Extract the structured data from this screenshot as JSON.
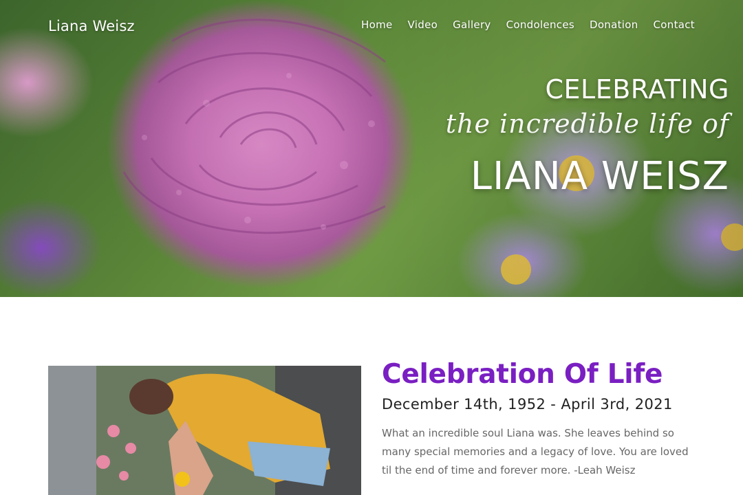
{
  "header": {
    "logo": "Liana Weisz",
    "nav": [
      "Home",
      "Video",
      "Gallery",
      "Condolences",
      "Donation",
      "Contact"
    ]
  },
  "hero": {
    "line1": "CELEBRATING",
    "line2": "the incredible life of",
    "name": "LIANA WEISZ"
  },
  "memorial": {
    "title": "Celebration Of Life",
    "dates": "December 14th, 1952 - April 3rd, 2021",
    "tribute": "What an incredible soul Liana was. She leaves behind so many special memories and a legacy of love. You are loved til the end of time and forever more. -Leah Weisz"
  },
  "colors": {
    "accent": "#7a1fc2",
    "text_dark": "#222222",
    "text_muted": "#666666"
  }
}
